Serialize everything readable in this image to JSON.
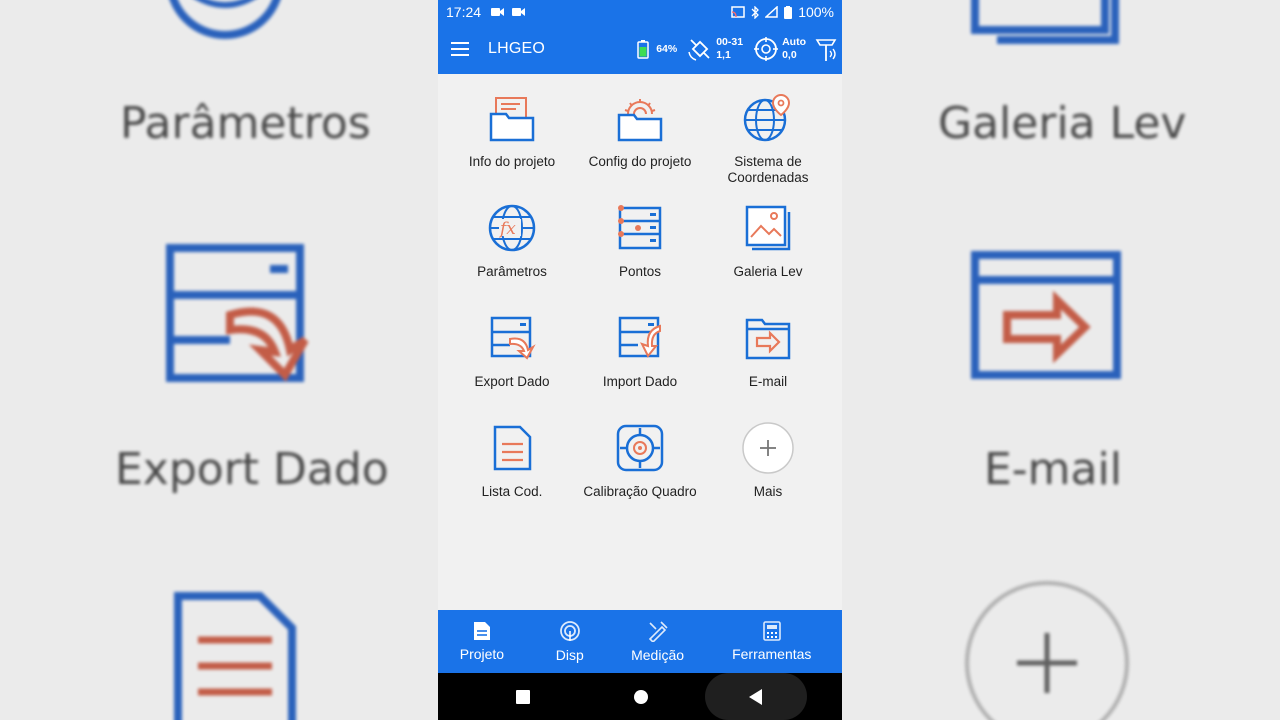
{
  "status_bar": {
    "time": "17:24",
    "battery": "100%"
  },
  "app_bar": {
    "title": "LHGEO",
    "battery": "64%",
    "sat_line1": "00-31",
    "sat_line2": "1,1",
    "solution_line1": "Auto",
    "solution_line2": "0,0"
  },
  "grid": [
    {
      "label": "Info do projeto",
      "icon": "project-info-folder-icon"
    },
    {
      "label": "Config do projeto",
      "icon": "project-config-folder-icon"
    },
    {
      "label": "Sistema de Coordenadas",
      "icon": "globe-pin-icon"
    },
    {
      "label": "Parâmetros",
      "icon": "globe-fx-icon"
    },
    {
      "label": "Pontos",
      "icon": "points-list-icon"
    },
    {
      "label": "Galeria Lev",
      "icon": "gallery-icon"
    },
    {
      "label": "Export Dado",
      "icon": "export-data-icon"
    },
    {
      "label": "Import Dado",
      "icon": "import-data-icon"
    },
    {
      "label": "E-mail",
      "icon": "email-folder-icon"
    },
    {
      "label": "Lista Cod.",
      "icon": "code-list-icon"
    },
    {
      "label": "Calibração Quadro",
      "icon": "calibration-target-icon"
    },
    {
      "label": "Mais",
      "icon": "plus-icon"
    }
  ],
  "bottom_nav": [
    {
      "label": "Projeto",
      "icon": "document-icon"
    },
    {
      "label": "Disp",
      "icon": "device-icon"
    },
    {
      "label": "Medição",
      "icon": "survey-icon"
    },
    {
      "label": "Ferramentas",
      "icon": "calculator-icon"
    }
  ],
  "background_labels": {
    "left_1": "Parâmetros",
    "left_2": "Export Dado",
    "right_1": "Galeria Lev",
    "right_2": "E-mail"
  },
  "colors": {
    "accent": "#1a73e8",
    "icon_blue": "#1a6fd6",
    "icon_orange": "#e8795a"
  }
}
